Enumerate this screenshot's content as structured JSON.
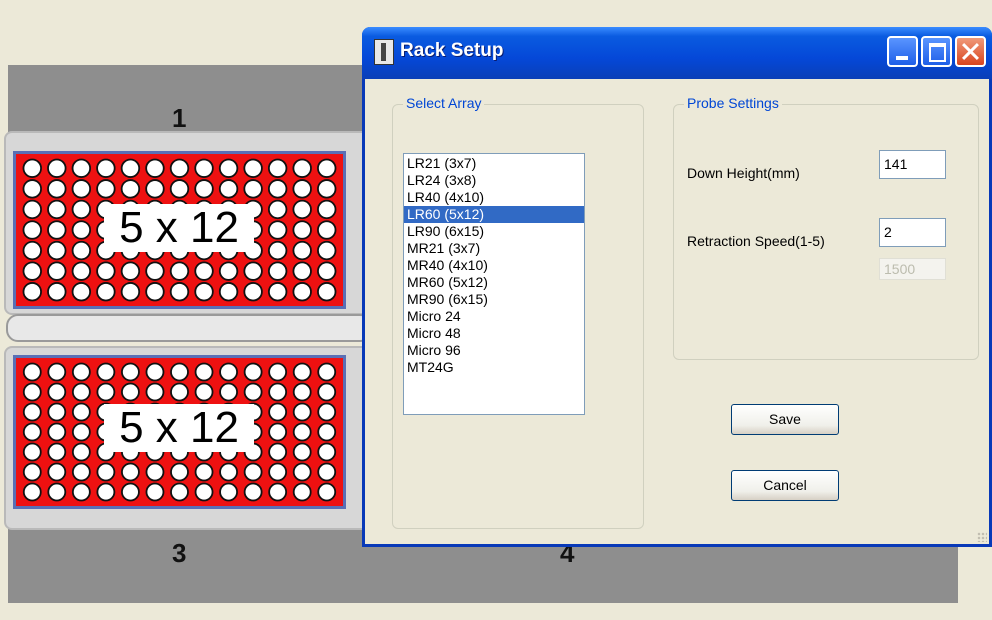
{
  "background_app": {
    "rack_numbers": [
      "1",
      "3",
      "4"
    ],
    "plates": [
      {
        "label": "5 x 12",
        "rows": 7,
        "cols": 13
      },
      {
        "label": "5 x 12",
        "rows": 7,
        "cols": 13
      }
    ],
    "colors": {
      "plate": "#ee1111",
      "band": "#8e8e8e",
      "plate_border": "#5a6fb5"
    }
  },
  "dialog": {
    "title": "Rack Setup",
    "select_array": {
      "title": "Select Array",
      "items": [
        "LR21 (3x7)",
        "LR24 (3x8)",
        "LR40 (4x10)",
        "LR60 (5x12)",
        "LR90 (6x15)",
        "MR21 (3x7)",
        "MR40 (4x10)",
        "MR60 (5x12)",
        "MR90 (6x15)",
        "Micro 24",
        "Micro 48",
        "Micro 96",
        "MT24G"
      ],
      "selected": "LR60 (5x12)"
    },
    "probe_settings": {
      "title": "Probe Settings",
      "down_height_label": "Down Height(mm)",
      "down_height_value": "141",
      "retraction_speed_label": "Retraction Speed(1-5)",
      "retraction_speed_value": "2",
      "disabled_value": "1500"
    },
    "save_label": "Save",
    "cancel_label": "Cancel",
    "colors": {
      "titlebar": "#0548d8",
      "group_title": "#0046d5",
      "selection": "#316ac5"
    }
  }
}
